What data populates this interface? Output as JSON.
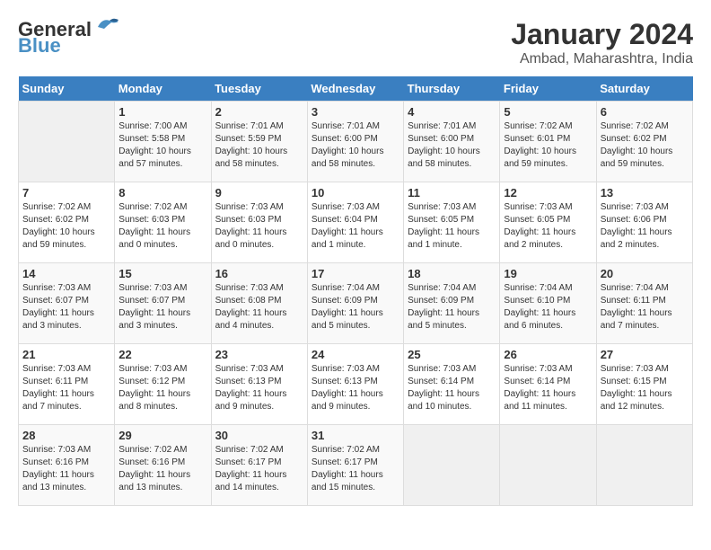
{
  "logo": {
    "general": "General",
    "blue": "Blue"
  },
  "title": "January 2024",
  "location": "Ambad, Maharashtra, India",
  "days_of_week": [
    "Sunday",
    "Monday",
    "Tuesday",
    "Wednesday",
    "Thursday",
    "Friday",
    "Saturday"
  ],
  "weeks": [
    [
      {
        "day": "",
        "sunrise": "",
        "sunset": "",
        "daylight": ""
      },
      {
        "day": "1",
        "sunrise": "Sunrise: 7:00 AM",
        "sunset": "Sunset: 5:58 PM",
        "daylight": "Daylight: 10 hours and 57 minutes."
      },
      {
        "day": "2",
        "sunrise": "Sunrise: 7:01 AM",
        "sunset": "Sunset: 5:59 PM",
        "daylight": "Daylight: 10 hours and 58 minutes."
      },
      {
        "day": "3",
        "sunrise": "Sunrise: 7:01 AM",
        "sunset": "Sunset: 6:00 PM",
        "daylight": "Daylight: 10 hours and 58 minutes."
      },
      {
        "day": "4",
        "sunrise": "Sunrise: 7:01 AM",
        "sunset": "Sunset: 6:00 PM",
        "daylight": "Daylight: 10 hours and 58 minutes."
      },
      {
        "day": "5",
        "sunrise": "Sunrise: 7:02 AM",
        "sunset": "Sunset: 6:01 PM",
        "daylight": "Daylight: 10 hours and 59 minutes."
      },
      {
        "day": "6",
        "sunrise": "Sunrise: 7:02 AM",
        "sunset": "Sunset: 6:02 PM",
        "daylight": "Daylight: 10 hours and 59 minutes."
      }
    ],
    [
      {
        "day": "7",
        "sunrise": "Sunrise: 7:02 AM",
        "sunset": "Sunset: 6:02 PM",
        "daylight": "Daylight: 10 hours and 59 minutes."
      },
      {
        "day": "8",
        "sunrise": "Sunrise: 7:02 AM",
        "sunset": "Sunset: 6:03 PM",
        "daylight": "Daylight: 11 hours and 0 minutes."
      },
      {
        "day": "9",
        "sunrise": "Sunrise: 7:03 AM",
        "sunset": "Sunset: 6:03 PM",
        "daylight": "Daylight: 11 hours and 0 minutes."
      },
      {
        "day": "10",
        "sunrise": "Sunrise: 7:03 AM",
        "sunset": "Sunset: 6:04 PM",
        "daylight": "Daylight: 11 hours and 1 minute."
      },
      {
        "day": "11",
        "sunrise": "Sunrise: 7:03 AM",
        "sunset": "Sunset: 6:05 PM",
        "daylight": "Daylight: 11 hours and 1 minute."
      },
      {
        "day": "12",
        "sunrise": "Sunrise: 7:03 AM",
        "sunset": "Sunset: 6:05 PM",
        "daylight": "Daylight: 11 hours and 2 minutes."
      },
      {
        "day": "13",
        "sunrise": "Sunrise: 7:03 AM",
        "sunset": "Sunset: 6:06 PM",
        "daylight": "Daylight: 11 hours and 2 minutes."
      }
    ],
    [
      {
        "day": "14",
        "sunrise": "Sunrise: 7:03 AM",
        "sunset": "Sunset: 6:07 PM",
        "daylight": "Daylight: 11 hours and 3 minutes."
      },
      {
        "day": "15",
        "sunrise": "Sunrise: 7:03 AM",
        "sunset": "Sunset: 6:07 PM",
        "daylight": "Daylight: 11 hours and 3 minutes."
      },
      {
        "day": "16",
        "sunrise": "Sunrise: 7:03 AM",
        "sunset": "Sunset: 6:08 PM",
        "daylight": "Daylight: 11 hours and 4 minutes."
      },
      {
        "day": "17",
        "sunrise": "Sunrise: 7:04 AM",
        "sunset": "Sunset: 6:09 PM",
        "daylight": "Daylight: 11 hours and 5 minutes."
      },
      {
        "day": "18",
        "sunrise": "Sunrise: 7:04 AM",
        "sunset": "Sunset: 6:09 PM",
        "daylight": "Daylight: 11 hours and 5 minutes."
      },
      {
        "day": "19",
        "sunrise": "Sunrise: 7:04 AM",
        "sunset": "Sunset: 6:10 PM",
        "daylight": "Daylight: 11 hours and 6 minutes."
      },
      {
        "day": "20",
        "sunrise": "Sunrise: 7:04 AM",
        "sunset": "Sunset: 6:11 PM",
        "daylight": "Daylight: 11 hours and 7 minutes."
      }
    ],
    [
      {
        "day": "21",
        "sunrise": "Sunrise: 7:03 AM",
        "sunset": "Sunset: 6:11 PM",
        "daylight": "Daylight: 11 hours and 7 minutes."
      },
      {
        "day": "22",
        "sunrise": "Sunrise: 7:03 AM",
        "sunset": "Sunset: 6:12 PM",
        "daylight": "Daylight: 11 hours and 8 minutes."
      },
      {
        "day": "23",
        "sunrise": "Sunrise: 7:03 AM",
        "sunset": "Sunset: 6:13 PM",
        "daylight": "Daylight: 11 hours and 9 minutes."
      },
      {
        "day": "24",
        "sunrise": "Sunrise: 7:03 AM",
        "sunset": "Sunset: 6:13 PM",
        "daylight": "Daylight: 11 hours and 9 minutes."
      },
      {
        "day": "25",
        "sunrise": "Sunrise: 7:03 AM",
        "sunset": "Sunset: 6:14 PM",
        "daylight": "Daylight: 11 hours and 10 minutes."
      },
      {
        "day": "26",
        "sunrise": "Sunrise: 7:03 AM",
        "sunset": "Sunset: 6:14 PM",
        "daylight": "Daylight: 11 hours and 11 minutes."
      },
      {
        "day": "27",
        "sunrise": "Sunrise: 7:03 AM",
        "sunset": "Sunset: 6:15 PM",
        "daylight": "Daylight: 11 hours and 12 minutes."
      }
    ],
    [
      {
        "day": "28",
        "sunrise": "Sunrise: 7:03 AM",
        "sunset": "Sunset: 6:16 PM",
        "daylight": "Daylight: 11 hours and 13 minutes."
      },
      {
        "day": "29",
        "sunrise": "Sunrise: 7:02 AM",
        "sunset": "Sunset: 6:16 PM",
        "daylight": "Daylight: 11 hours and 13 minutes."
      },
      {
        "day": "30",
        "sunrise": "Sunrise: 7:02 AM",
        "sunset": "Sunset: 6:17 PM",
        "daylight": "Daylight: 11 hours and 14 minutes."
      },
      {
        "day": "31",
        "sunrise": "Sunrise: 7:02 AM",
        "sunset": "Sunset: 6:17 PM",
        "daylight": "Daylight: 11 hours and 15 minutes."
      },
      {
        "day": "",
        "sunrise": "",
        "sunset": "",
        "daylight": ""
      },
      {
        "day": "",
        "sunrise": "",
        "sunset": "",
        "daylight": ""
      },
      {
        "day": "",
        "sunrise": "",
        "sunset": "",
        "daylight": ""
      }
    ]
  ]
}
